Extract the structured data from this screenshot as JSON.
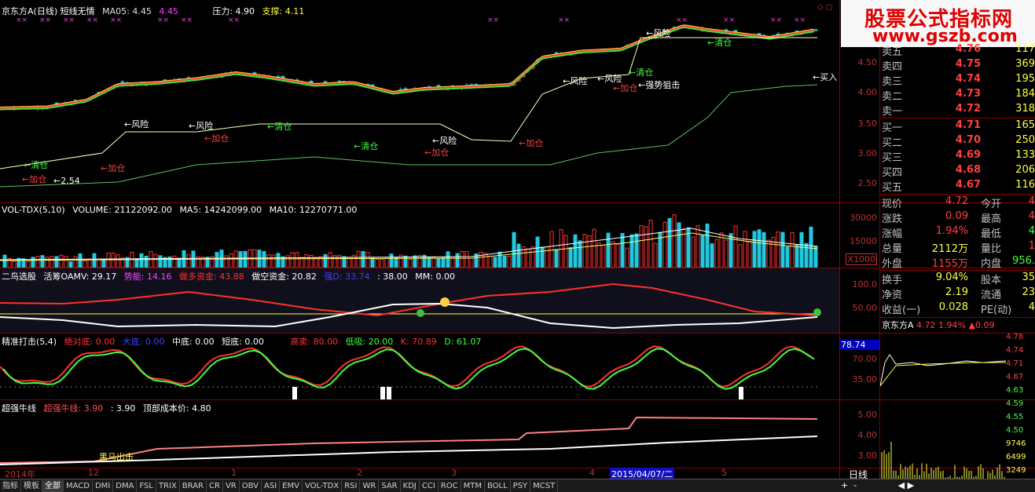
{
  "main": {
    "title": "京东方A(日线) 短线无情",
    "ma05_label": "MA05: 4.45",
    "ma05_value": "4.45",
    "pressure": "压力: 4.90",
    "support": "支撑: 4.11",
    "axis_ticks": [
      "4.50",
      "4.00",
      "3.50",
      "3.00",
      "2.50"
    ],
    "annotations": [
      "风险",
      "风险",
      "风险",
      "风险",
      "风险",
      "风险",
      "清仓",
      "清仓",
      "清仓",
      "清仓",
      "清仓",
      "加仓",
      "加仓",
      "加仓",
      "加仓",
      "加仓",
      "加仓",
      "加仓",
      "2.54",
      "强势狙击",
      "买入",
      "5风险"
    ]
  },
  "volume": {
    "title": "VOL-TDX(5,10)",
    "volume": "VOLUME: 21122092.00",
    "ma5": "MA5: 14242099.00",
    "ma10": "MA10: 12270771.00",
    "axis_ticks": [
      "30000",
      "15000"
    ],
    "unit": "X1000"
  },
  "erniao": {
    "title": "二鸟选股",
    "huochou": "活筹OAMV: 29.17",
    "shineng": "势能: 14.16",
    "duoduo": "做多资金: 43.88",
    "zuokong": "做空资金: 20.82",
    "qiangdu": "强D: 33.74",
    "v38": ": 38.00",
    "mm": "MM: 0.00",
    "axis_ticks": [
      "100.0",
      "50.00"
    ]
  },
  "jingzhun": {
    "title": "精准打击(5,4)",
    "juedi": "绝对底: 0.00",
    "dadi": "大底: 0.00",
    "zhongdi": "中底: 0.00",
    "duandi": "短底: 0.00",
    "gaomai": "高卖: 80.00",
    "dixi": "低吸: 20.00",
    "k": "K: 70.89",
    "d": "D: 61.07",
    "axis_value": "78.74",
    "axis_ticks": [
      "70.00",
      "35.00"
    ]
  },
  "chaoqiang": {
    "title": "超强牛线",
    "line1": "超强牛线: 3.90",
    "line2": ": 3.90",
    "top_cost": "顶部成本价: 4.80",
    "axis_ticks": [
      "5.00",
      "4.00",
      "3.00"
    ],
    "mark": "黑马出击"
  },
  "dates": {
    "items": [
      "2014年",
      "12",
      "1",
      "2",
      "3",
      "4",
      "2015/04/07/二",
      "5"
    ],
    "period": "日线"
  },
  "tabs": [
    "指标",
    "模板",
    "全部",
    "MACD",
    "DMI",
    "DMA",
    "FSL",
    "TRIX",
    "BRAR",
    "CR",
    "VR",
    "OBV",
    "ASI",
    "EMV",
    "VOL-TDX",
    "RSI",
    "WR",
    "SAR",
    "KDJ",
    "CCI",
    "ROC",
    "MTM",
    "BOLL",
    "PSY",
    "MCST"
  ],
  "logo": {
    "line1": "股票公式指标网",
    "line2": "www.gszb.com"
  },
  "orderbook": {
    "sells": [
      {
        "label": "卖五",
        "price": "4.76",
        "vol": "117"
      },
      {
        "label": "卖四",
        "price": "4.75",
        "vol": "369"
      },
      {
        "label": "卖三",
        "price": "4.74",
        "vol": "195"
      },
      {
        "label": "卖二",
        "price": "4.73",
        "vol": "184"
      },
      {
        "label": "卖一",
        "price": "4.72",
        "vol": "318"
      }
    ],
    "buys": [
      {
        "label": "买一",
        "price": "4.71",
        "vol": "165"
      },
      {
        "label": "买二",
        "price": "4.70",
        "vol": "250"
      },
      {
        "label": "买三",
        "price": "4.69",
        "vol": "133"
      },
      {
        "label": "买四",
        "price": "4.68",
        "vol": "206"
      },
      {
        "label": "买五",
        "price": "4.67",
        "vol": "116"
      }
    ]
  },
  "stats": [
    {
      "l": "现价",
      "v1": "4.72",
      "l2": "今开",
      "v2": "4"
    },
    {
      "l": "涨跌",
      "v1": "0.09",
      "l2": "最高",
      "v2": "4"
    },
    {
      "l": "涨幅",
      "v1": "1.94%",
      "l2": "最低",
      "v2": "4"
    },
    {
      "l": "总量",
      "v1": "2112万",
      "l2": "量比",
      "v2": "1"
    },
    {
      "l": "外盘",
      "v1": "1155万",
      "l2": "内盘",
      "v2": "956."
    }
  ],
  "stats2": [
    {
      "l": "换手",
      "v1": "9.04%",
      "l2": "股本",
      "v2": "35"
    },
    {
      "l": "净资",
      "v1": "2.19",
      "l2": "流通",
      "v2": "23"
    },
    {
      "l": "收益(一)",
      "v1": "0.028",
      "l2": "PE(动)",
      "v2": "4"
    }
  ],
  "mini": {
    "title": "京东方A",
    "price": "4.72",
    "pct": "1.94%",
    "chg": "▲0.09",
    "ticks": [
      "4.78",
      "4.74",
      "4.71",
      "4.67",
      "4.63",
      "4.59",
      "4.55",
      "4.50",
      "9746",
      "6499",
      "3249"
    ]
  }
}
